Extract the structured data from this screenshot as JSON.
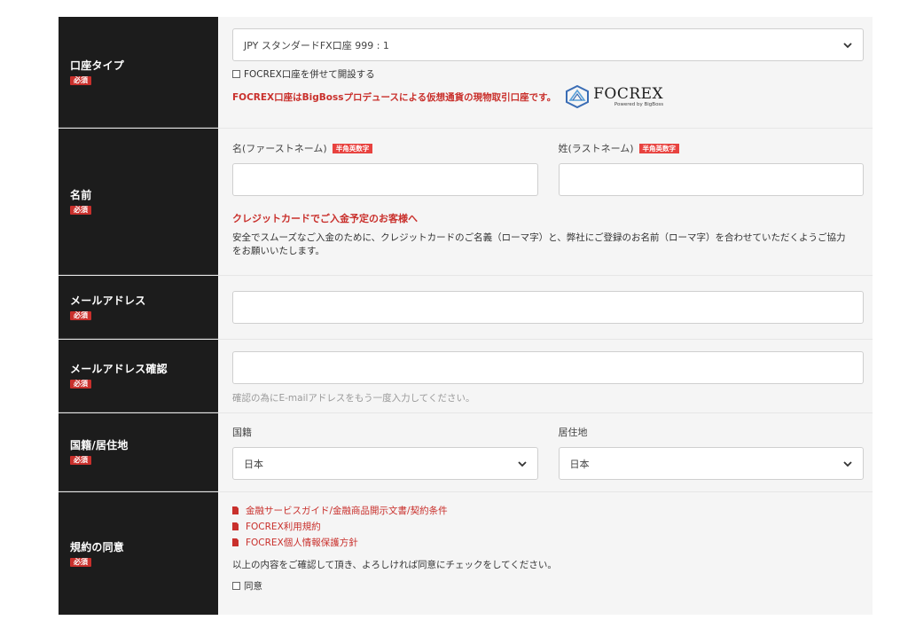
{
  "required_badge": "必須",
  "halfwidth_tag": "半角英数字",
  "account": {
    "label": "口座タイプ",
    "select_value": "JPY スタンダードFX口座 999 : 1",
    "checkbox_label": "FOCREX口座を併せて開設する",
    "promo": "FOCREX口座はBigBossプロデュースによる仮想通貨の現物取引口座です。",
    "logo_word": "FOCREX",
    "logo_sub": "Powered by BigBoss"
  },
  "name": {
    "label": "名前",
    "first_label": "名(ファーストネーム)",
    "last_label": "姓(ラストネーム)",
    "first_value": "",
    "last_value": "",
    "card_heading": "クレジットカードでご入金予定のお客様へ",
    "card_note": "安全でスムーズなご入金のために、クレジットカードのご名義（ローマ字）と、弊社にご登録のお名前（ローマ字）を合わせていただくようご協力をお願いいたします。"
  },
  "email": {
    "label": "メールアドレス",
    "value": ""
  },
  "email_confirm": {
    "label": "メールアドレス確認",
    "value": "",
    "hint": "確認の為にE-mailアドレスをもう一度入力してください。"
  },
  "country": {
    "label": "国籍/居住地",
    "nationality_label": "国籍",
    "nationality_value": "日本",
    "residence_label": "居住地",
    "residence_value": "日本"
  },
  "terms": {
    "label": "規約の同意",
    "links": [
      "金融サービスガイド/金融商品開示文書/契約条件",
      "FOCREX利用規約",
      "FOCREX個人情報保護方針"
    ],
    "note": "以上の内容をご確認して頂き、よろしければ同意にチェックをしてください。",
    "agree_label": "同意"
  },
  "colors": {
    "label_bg": "#1c1c1c",
    "field_bg": "#f5f5f5",
    "accent_red": "#c9302c"
  }
}
